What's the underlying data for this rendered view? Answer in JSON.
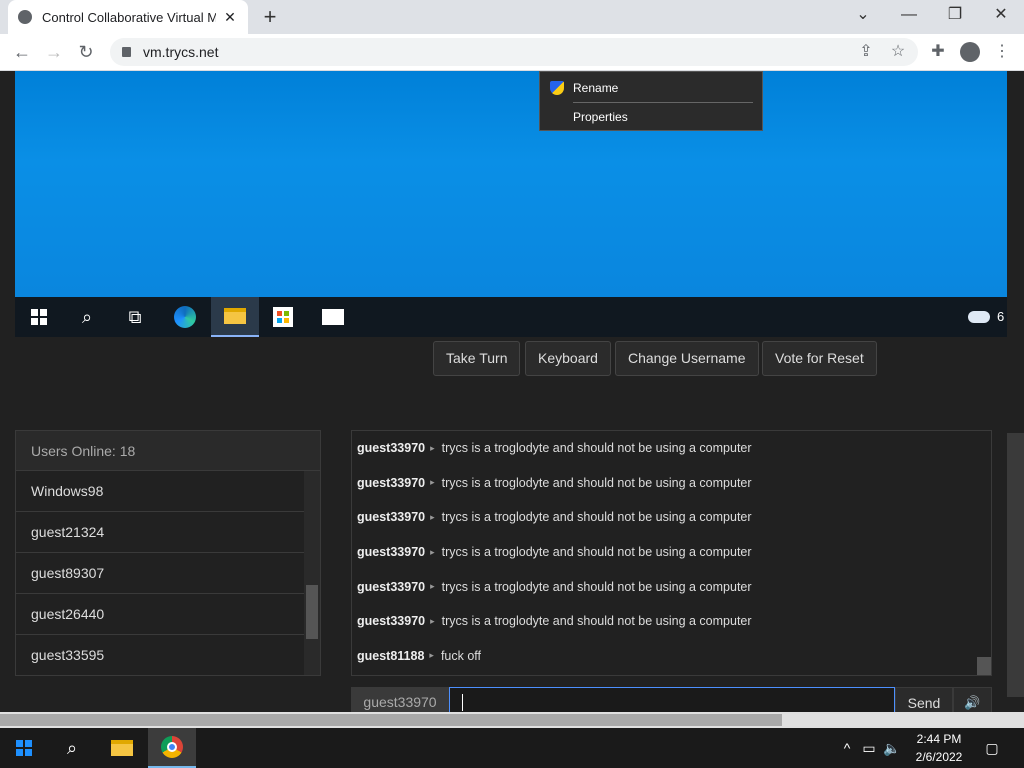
{
  "browser": {
    "tab_title": "Control Collaborative Virtual Mac",
    "tab_close": "✕",
    "new_tab": "+",
    "url": "vm.trycs.net",
    "window_controls": {
      "minimize": "—",
      "maximize": "❐",
      "close": "✕",
      "dropdown": "⌄"
    }
  },
  "vm": {
    "context_menu": [
      {
        "label": "Rename",
        "icon": "uac-shield-icon"
      },
      {
        "label": "Properties"
      }
    ],
    "taskbar_icons": [
      "windows-start-icon",
      "search-icon",
      "task-view-icon",
      "edge-icon",
      "file-explorer-icon",
      "store-icon",
      "mail-icon"
    ],
    "tray_text": "6"
  },
  "controls": {
    "take_turn": "Take Turn",
    "keyboard": "Keyboard",
    "change_username": "Change Username",
    "vote_reset": "Vote for Reset"
  },
  "users": {
    "header": "Users Online: 18",
    "list": [
      "Windows98",
      "guest21324",
      "guest89307",
      "guest26440",
      "guest33595"
    ]
  },
  "chat": {
    "messages": [
      {
        "user": "guest33970",
        "text": "trycs is a troglodyte and should not be using a computer"
      },
      {
        "user": "guest33970",
        "text": "trycs is a troglodyte and should not be using a computer"
      },
      {
        "user": "guest33970",
        "text": "trycs is a troglodyte and should not be using a computer"
      },
      {
        "user": "guest33970",
        "text": "trycs is a troglodyte and should not be using a computer"
      },
      {
        "user": "guest33970",
        "text": "trycs is a troglodyte and should not be using a computer"
      },
      {
        "user": "guest33970",
        "text": "trycs is a troglodyte and should not be using a computer"
      },
      {
        "user": "guest81188",
        "text": "fuck off"
      }
    ],
    "username": "guest33970",
    "input_value": "",
    "send": "Send",
    "sound_icon": "🔊"
  },
  "host": {
    "clock_time": "2:44 PM",
    "clock_date": "2/6/2022"
  }
}
